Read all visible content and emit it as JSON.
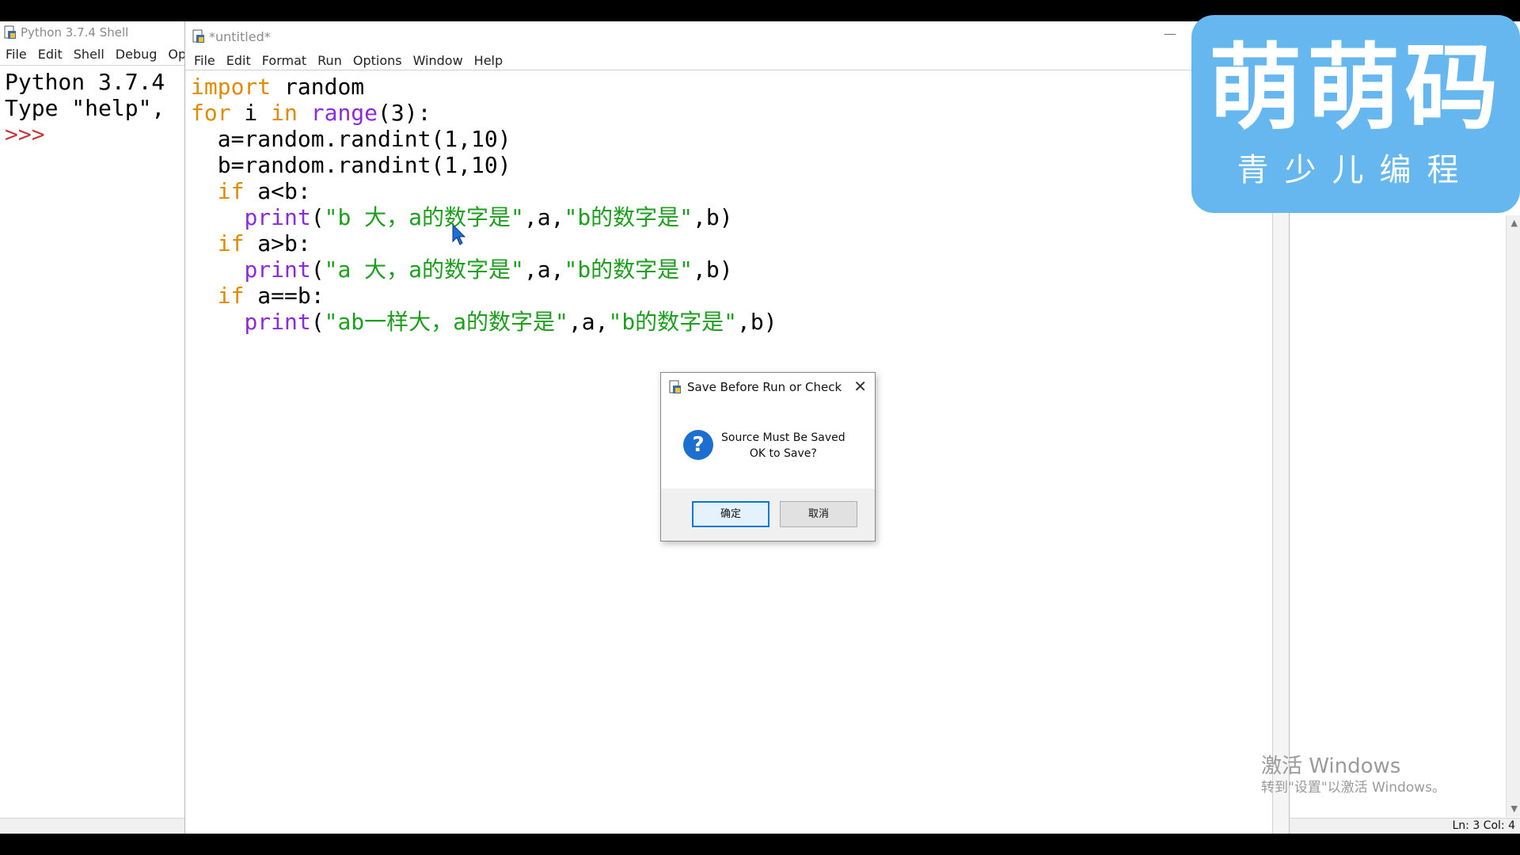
{
  "shell": {
    "title": "Python 3.7.4 Shell",
    "menu": [
      "File",
      "Edit",
      "Shell",
      "Debug",
      "Opti"
    ],
    "lines": [
      "Python 3.7.4 ",
      "Type \"help\", "
    ],
    "prompt": ">>>"
  },
  "editor": {
    "title": "*untitled*",
    "menu": [
      "File",
      "Edit",
      "Format",
      "Run",
      "Options",
      "Window",
      "Help"
    ],
    "code": {
      "l1_kw": "import",
      "l1_rest": " random",
      "l2_kw1": "for",
      "l2_a": " i ",
      "l2_kw2": "in",
      "l2_sp": " ",
      "l2_bi": "range",
      "l2_rest": "(3):",
      "l3": "  a=random.randint(1,10)",
      "l4": "  b=random.randint(1,10)",
      "l5_ind": "  ",
      "l5_kw": "if",
      "l5_rest": " a<b:",
      "l6_ind": "    ",
      "l6_bi": "print",
      "l6_p": "(",
      "l6_s1": "\"b 大，a的数字是\"",
      "l6_m": ",a,",
      "l6_s2": "\"b的数字是\"",
      "l6_e": ",b)",
      "l7_ind": "  ",
      "l7_kw": "if",
      "l7_rest": " a>b:",
      "l8_ind": "    ",
      "l8_bi": "print",
      "l8_p": "(",
      "l8_s1": "\"a 大，a的数字是\"",
      "l8_m": ",a,",
      "l8_s2": "\"b的数字是\"",
      "l8_e": ",b)",
      "l9_ind": "  ",
      "l9_kw": "if",
      "l9_rest": " a==b:",
      "l10_ind": "    ",
      "l10_bi": "print",
      "l10_p": "(",
      "l10_s1": "\"ab一样大，a的数字是\"",
      "l10_m": ",a,",
      "l10_s2": "\"b的数字是\"",
      "l10_e": ",b)"
    },
    "minimize": "—"
  },
  "dialog": {
    "title": "Save Before Run or Check",
    "message_line1": "Source Must Be Saved",
    "message_line2": "OK to Save?",
    "ok_label": "确定",
    "cancel_label": "取消",
    "close": "✕",
    "question": "?"
  },
  "status": {
    "position": "Ln: 3   Col: 4"
  },
  "watermark": {
    "line1": "激活 Windows",
    "line2": "转到\"设置\"以激活 Windows。"
  },
  "logo": {
    "title": "萌萌码",
    "subtitle": "青少儿编程"
  },
  "colors": {
    "keyword": "#e08a00",
    "builtin": "#8a2be2",
    "string": "#1e9e1e",
    "logo_bg": "#66b7ef",
    "dialog_accent": "#0078d7"
  }
}
